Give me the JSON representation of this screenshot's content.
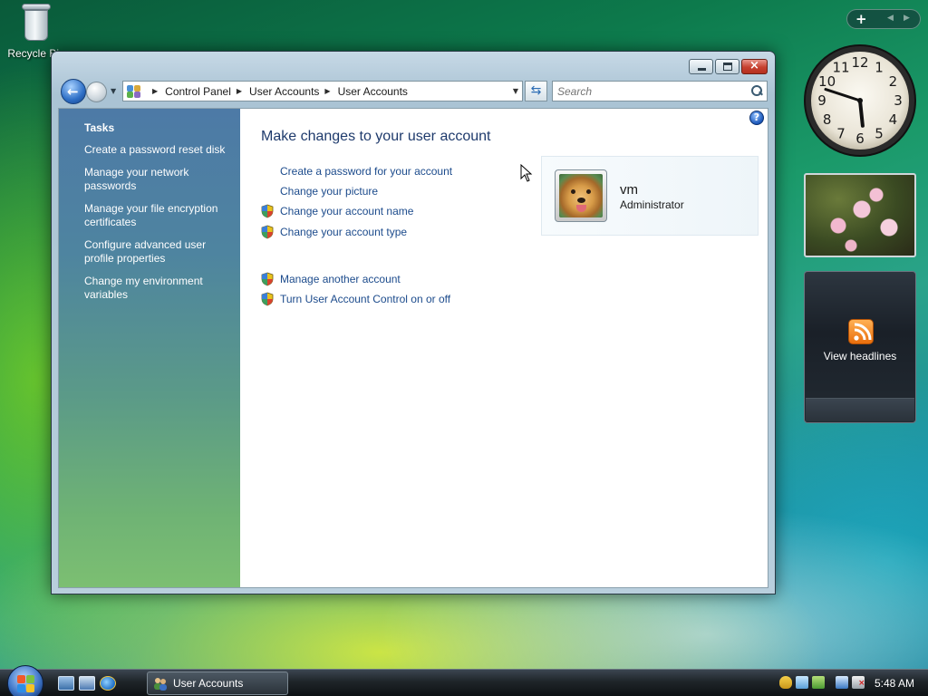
{
  "desktop": {
    "icons": [
      {
        "label": "Recycle Bin",
        "icon": "recycle-bin-icon"
      }
    ]
  },
  "window": {
    "controls": {
      "minimize": "minimize",
      "maximize": "maximize",
      "close": "×"
    },
    "address": {
      "breadcrumbs": [
        "Control Panel",
        "User Accounts",
        "User Accounts"
      ]
    },
    "search": {
      "placeholder": "Search"
    },
    "sidebar": {
      "heading": "Tasks",
      "items": [
        {
          "label": "Create a password reset disk"
        },
        {
          "label": "Manage your network passwords"
        },
        {
          "label": "Manage your file encryption certificates"
        },
        {
          "label": "Configure advanced user profile properties"
        },
        {
          "label": "Change my environment variables"
        }
      ]
    },
    "main": {
      "heading": "Make changes to your user account",
      "tasks": [
        {
          "label": "Create a password for your account",
          "shield": false
        },
        {
          "label": "Change your picture",
          "shield": false
        },
        {
          "label": "Change your account name",
          "shield": true
        },
        {
          "label": "Change your account type",
          "shield": true
        }
      ],
      "other_tasks": [
        {
          "label": "Manage another account",
          "shield": true
        },
        {
          "label": "Turn User Account Control on or off",
          "shield": true
        }
      ],
      "user": {
        "name": "vm",
        "role": "Administrator"
      }
    }
  },
  "gadgets": {
    "clock": {
      "numerals": [
        "12",
        "1",
        "2",
        "3",
        "4",
        "5",
        "6",
        "7",
        "8",
        "9",
        "10",
        "11"
      ],
      "time": "5:48"
    },
    "feed": {
      "label": "View headlines"
    }
  },
  "taskbar": {
    "open_window": "User Accounts",
    "time": "5:48 AM"
  },
  "colors": {
    "link": "#1c4b8c",
    "heading": "#1e3a6c",
    "sidebar_top": "#4d7aa6",
    "sidebar_bottom": "#7cbf72"
  }
}
